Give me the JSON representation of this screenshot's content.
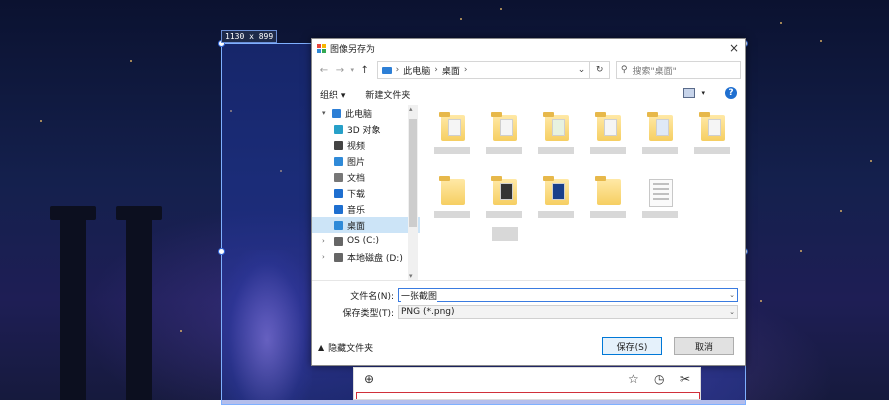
{
  "overlay": {
    "dimensions_badge": "1130 x 899"
  },
  "dialog": {
    "title": "图像另存为",
    "colors": {
      "accent": "#0078d7",
      "selection": "#cce4f7",
      "folder": "#f6cf62"
    },
    "address": {
      "crumbs": [
        "此电脑",
        "桌面"
      ],
      "separator": "›"
    },
    "search": {
      "placeholder": "搜索\"桌面\""
    },
    "toolbar": {
      "organize": "组织 ▾",
      "new_folder": "新建文件夹"
    },
    "tree": [
      {
        "label": "此电脑",
        "icon": "pc-icon",
        "color": "#2d7fd6"
      },
      {
        "label": "3D 对象",
        "icon": "cube-icon",
        "color": "#27a0c8"
      },
      {
        "label": "视频",
        "icon": "video-icon",
        "color": "#444"
      },
      {
        "label": "图片",
        "icon": "pictures-icon",
        "color": "#2f8ad8"
      },
      {
        "label": "文档",
        "icon": "document-icon",
        "color": "#777"
      },
      {
        "label": "下载",
        "icon": "download-icon",
        "color": "#1e6fd0"
      },
      {
        "label": "音乐",
        "icon": "music-icon",
        "color": "#1e6fd0"
      },
      {
        "label": "桌面",
        "icon": "desktop-icon",
        "color": "#2f8ad8",
        "selected": true
      },
      {
        "label": "OS (C:)",
        "icon": "drive-icon",
        "color": "#666"
      },
      {
        "label": "本地磁盘 (D:)",
        "icon": "drive-icon",
        "color": "#666"
      }
    ],
    "file_name": {
      "label": "文件名(N):",
      "value": "一张截图"
    },
    "file_type": {
      "label": "保存类型(T):",
      "value": "PNG (*.png)"
    },
    "hide_folders": "隐藏文件夹",
    "save": "保存(S)",
    "cancel": "取消"
  }
}
